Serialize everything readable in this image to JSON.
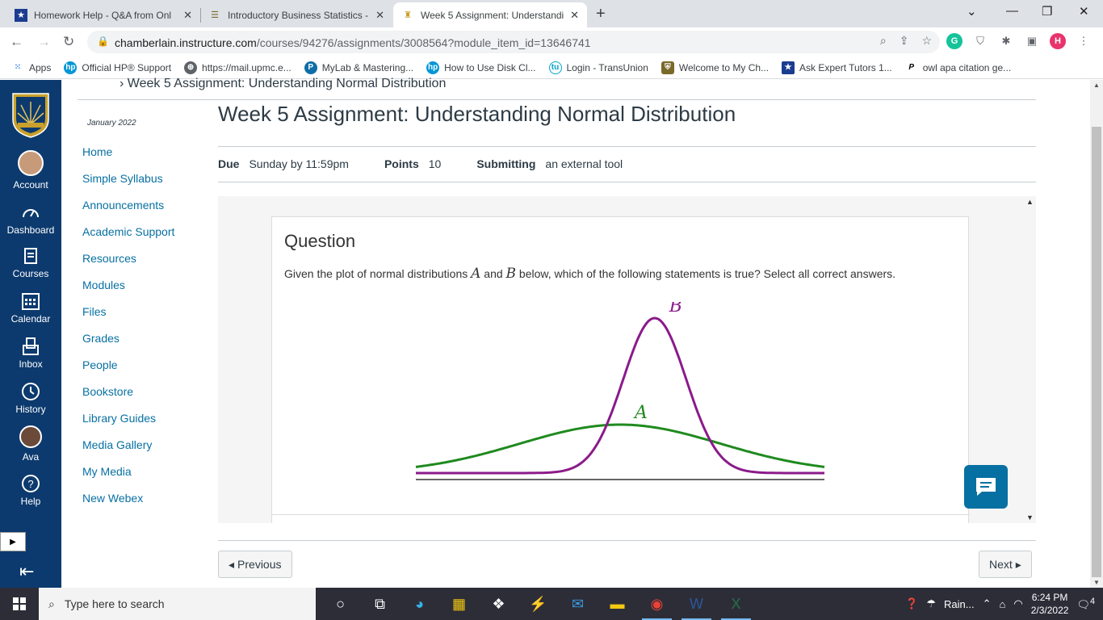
{
  "browser": {
    "tabs": [
      {
        "title": "Homework Help - Q&A from Onl",
        "icon": "star-icon"
      },
      {
        "title": "Introductory Business Statistics -",
        "icon": "document-icon"
      },
      {
        "title": "Week 5 Assignment: Understandi",
        "icon": "chamberlain-icon",
        "active": true
      }
    ],
    "new_tab": "+",
    "url_host": "chamberlain.instructure.com",
    "url_path": "/courses/94276/assignments/3008564?module_item_id=13646741",
    "profile_letter": "H"
  },
  "bookmarks": [
    {
      "label": "Apps",
      "icon": "apps-icon"
    },
    {
      "label": "Official HP® Support",
      "icon": "hp-icon"
    },
    {
      "label": "https://mail.upmc.e...",
      "icon": "globe-icon"
    },
    {
      "label": "MyLab & Mastering...",
      "icon": "pearson-icon"
    },
    {
      "label": "How to Use Disk Cl...",
      "icon": "hp-icon"
    },
    {
      "label": "Login - TransUnion",
      "icon": "transunion-icon"
    },
    {
      "label": "Welcome to My Ch...",
      "icon": "crest-icon"
    },
    {
      "label": "Ask Expert Tutors 1...",
      "icon": "star-icon"
    },
    {
      "label": "owl apa citation ge...",
      "icon": "purdue-icon"
    }
  ],
  "global_nav": {
    "account": "Account",
    "dashboard": "Dashboard",
    "courses": "Courses",
    "calendar": "Calendar",
    "inbox": "Inbox",
    "history": "History",
    "ava": "Ava",
    "help": "Help"
  },
  "breadcrumb": "Week 5 Assignment: Understanding Normal Distribution",
  "term": "January 2022",
  "course_nav": [
    "Home",
    "Simple Syllabus",
    "Announcements",
    "Academic Support",
    "Resources",
    "Modules",
    "Files",
    "Grades",
    "People",
    "Bookstore",
    "Library Guides",
    "Media Gallery",
    "My Media",
    "New Webex"
  ],
  "assignment": {
    "title": "Week 5 Assignment: Understanding Normal Distribution",
    "due_label": "Due",
    "due_value": "Sunday by 11:59pm",
    "points_label": "Points",
    "points_value": "10",
    "submitting_label": "Submitting",
    "submitting_value": "an external tool"
  },
  "question": {
    "heading": "Question",
    "text_before": "Given the plot of normal distributions ",
    "var_a": "A",
    "text_mid": " and ",
    "var_b": "B",
    "text_after": " below, which of the following statements is true? Select all correct answers."
  },
  "chart_data": {
    "type": "line",
    "title": "",
    "xlabel": "",
    "ylabel": "",
    "grid": false,
    "series": [
      {
        "name": "A",
        "color": "#1f8a1f",
        "mean": 0,
        "sd": 3.2
      },
      {
        "name": "B",
        "color": "#8b1a8b",
        "mean": 1.1,
        "sd": 1.0
      }
    ],
    "xlim": [
      -6.5,
      6.5
    ]
  },
  "footer": {
    "previous": "Previous",
    "next": "Next"
  },
  "taskbar": {
    "search_placeholder": "Type here to search",
    "weather": "Rain...",
    "time": "6:24 PM",
    "date": "2/3/2022",
    "notifications": "4"
  },
  "colors": {
    "canvas_nav": "#0c3a6e",
    "link": "#0770a3",
    "series_a": "#1f8a1f",
    "series_b": "#8b1a8b"
  }
}
